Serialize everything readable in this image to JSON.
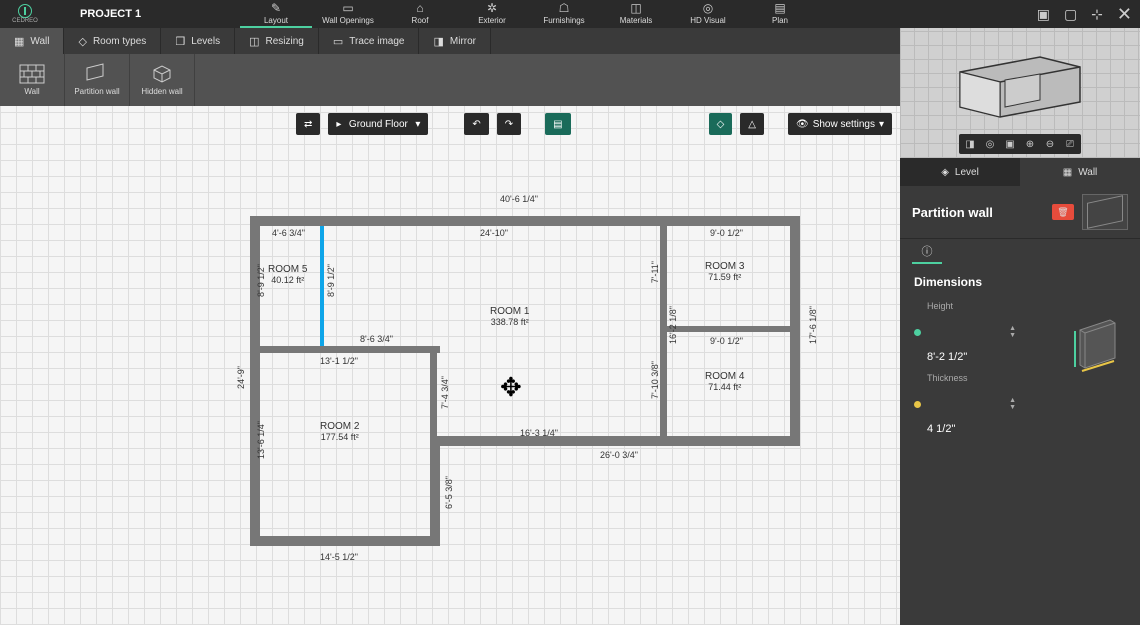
{
  "brand": "CEDREO",
  "project": "PROJECT 1",
  "mainTabs": [
    {
      "label": "Layout",
      "icon": "✎",
      "active": true
    },
    {
      "label": "Wall Openings",
      "icon": "▭"
    },
    {
      "label": "Roof",
      "icon": "⌂"
    },
    {
      "label": "Exterior",
      "icon": "✦"
    },
    {
      "label": "Furnishings",
      "icon": "🛋"
    },
    {
      "label": "Materials",
      "icon": "◫"
    },
    {
      "label": "HD Visual",
      "icon": "◉"
    },
    {
      "label": "Plan",
      "icon": "▤"
    }
  ],
  "subTabs": [
    {
      "label": "Wall",
      "icon": "▦",
      "active": true
    },
    {
      "label": "Room types",
      "icon": "◇"
    },
    {
      "label": "Levels",
      "icon": "❒"
    },
    {
      "label": "Resizing",
      "icon": "⟷"
    },
    {
      "label": "Trace image",
      "icon": "▭"
    },
    {
      "label": "Mirror",
      "icon": "◑"
    }
  ],
  "tools": [
    {
      "label": "Wall",
      "icon": "brick"
    },
    {
      "label": "Partition wall",
      "icon": "panel"
    },
    {
      "label": "Hidden wall",
      "icon": "cube"
    }
  ],
  "floorSelector": "Ground Floor",
  "showSettings": "Show settings",
  "rooms": [
    {
      "name": "ROOM 1",
      "area": "338.78 ft²"
    },
    {
      "name": "ROOM 2",
      "area": "177.54 ft²"
    },
    {
      "name": "ROOM 3",
      "area": "71.59 ft²"
    },
    {
      "name": "ROOM 4",
      "area": "71.44 ft²"
    },
    {
      "name": "ROOM 5",
      "area": "40.12 ft²"
    }
  ],
  "dimensions": {
    "top_total": "40'-6 1/4\"",
    "room5_w": "4'-6 3/4\"",
    "room1_w": "24'-10\"",
    "room3_w": "9'-0 1/2\"",
    "room5_h": "8'-9 1/2\"",
    "room5_h2": "8'-9 1/2\"",
    "below_r5": "8'-6 3/4\"",
    "r2_top": "13'-1 1/2\"",
    "r1_split": "7'-4 3/4\"",
    "r3_h": "7'-11\"",
    "r4_w": "9'-0 1/2\"",
    "mid_h": "16'-2 1/8\"",
    "r4_h": "7'-10 3/8\"",
    "right_h": "17'-6 1/8\"",
    "r1_bottom": "16'-3 1/4\"",
    "r2_h": "13'-6 1/4\"",
    "left_h": "24'-9\"",
    "bottom_right": "26'-0 3/4\"",
    "r2_right": "6'-5 3/8\"",
    "r2_bottom": "14'-5 1/2\""
  },
  "sideTabs": [
    {
      "label": "Level",
      "icon": "◈"
    },
    {
      "label": "Wall",
      "icon": "▦",
      "active": true
    }
  ],
  "panel": {
    "title": "Partition wall",
    "section": "Dimensions",
    "height": {
      "label": "Height",
      "value": "8'-2 1/2\"",
      "color": "#4dd0a0"
    },
    "thickness": {
      "label": "Thickness",
      "value": "4 1/2\"",
      "color": "#e8c547"
    }
  }
}
